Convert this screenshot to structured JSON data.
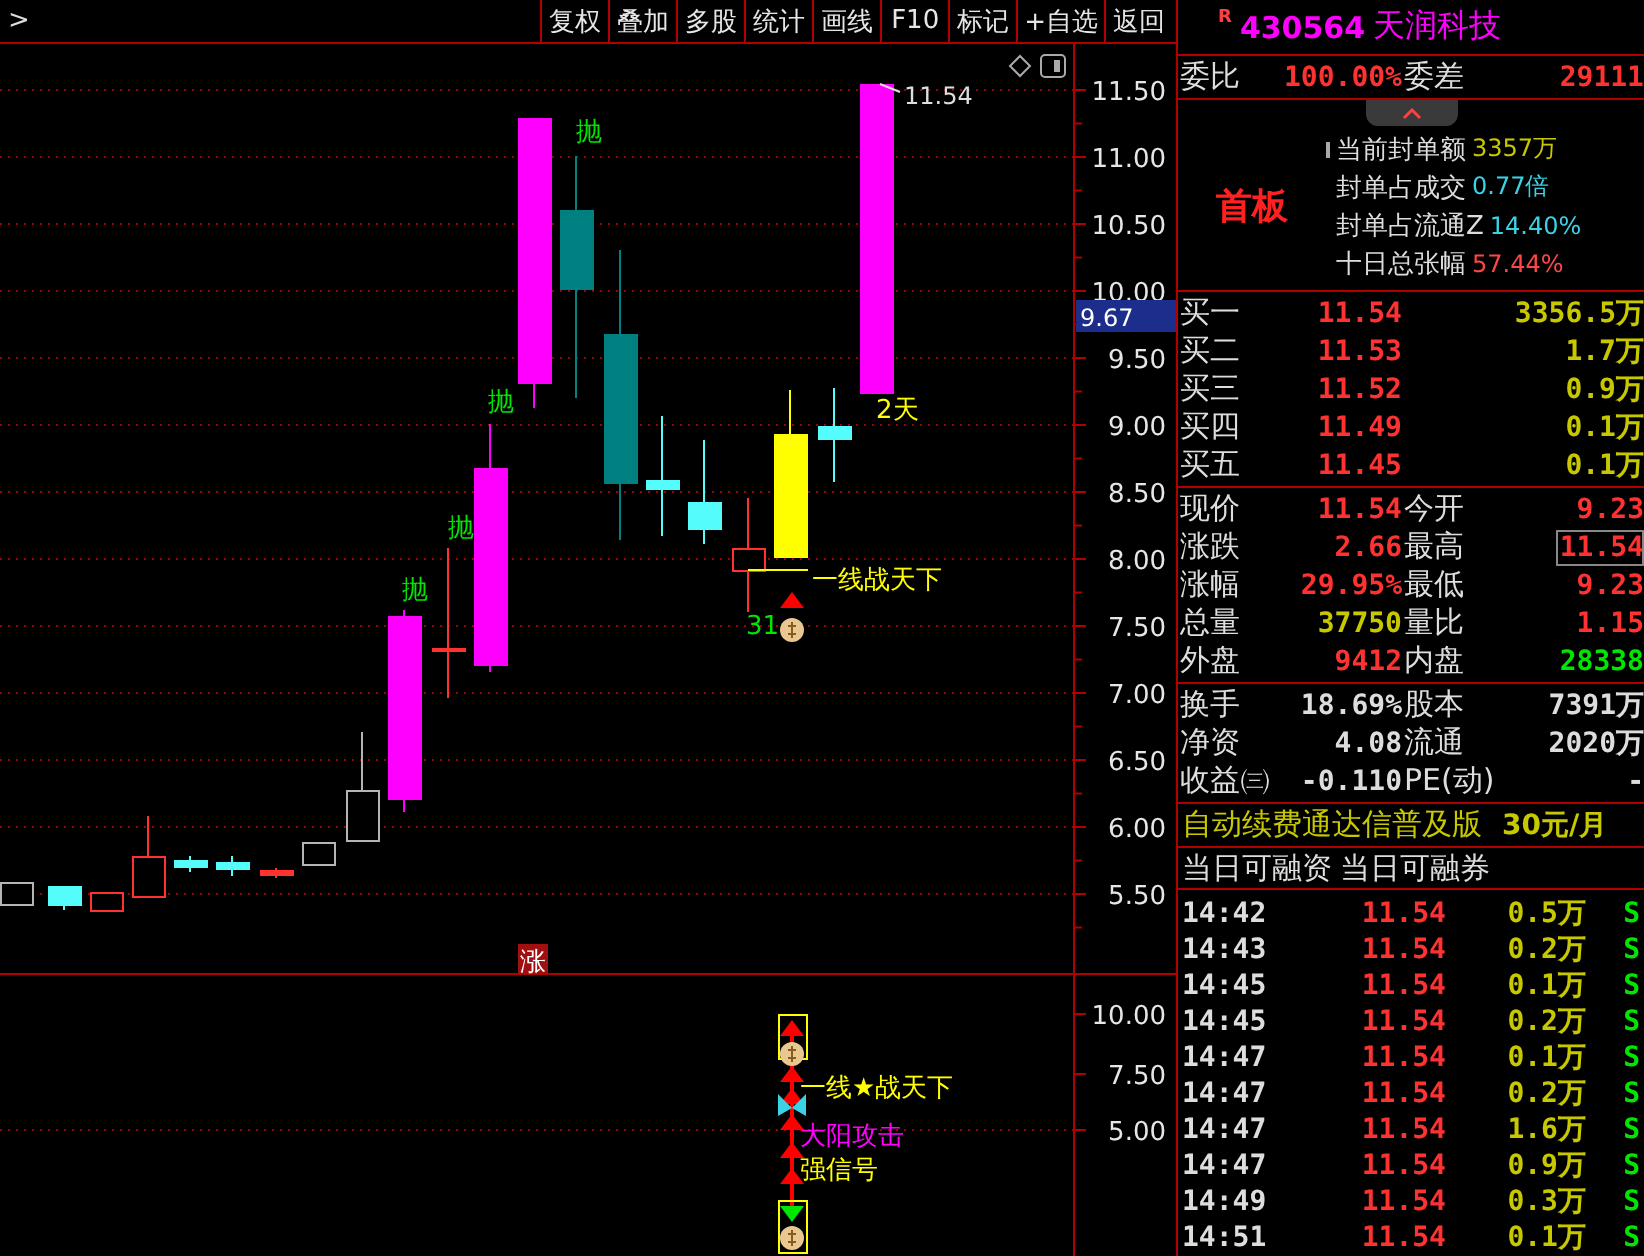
{
  "toolbar": {
    "breadcrumb": ">",
    "buttons": [
      "复权",
      "叠加",
      "多股",
      "统计",
      "画线",
      "F10",
      "标记",
      "+自选",
      "返回"
    ]
  },
  "chart": {
    "price_axis": [
      "11.50",
      "11.00",
      "10.50",
      "10.00",
      "9.50",
      "9.00",
      "8.50",
      "8.00",
      "7.50",
      "7.00",
      "6.50",
      "6.00",
      "5.50"
    ],
    "last_price_marker": "9.67",
    "high_label": "11.54",
    "rise_badge": "涨",
    "annotations": [
      {
        "text": "抛",
        "kind": "sell"
      },
      {
        "text": "抛",
        "kind": "sell"
      },
      {
        "text": "抛",
        "kind": "sell"
      },
      {
        "text": "抛",
        "kind": "sell"
      },
      {
        "text": "2天",
        "kind": "notice"
      },
      {
        "text": "一线战天下",
        "kind": "notice"
      },
      {
        "text": "31",
        "kind": "sell"
      }
    ],
    "indicator_axis": [
      "10.00",
      "7.50",
      "5.00"
    ],
    "signals": [
      {
        "text": "一线★战天下",
        "kind": "notice"
      },
      {
        "text": "大阳攻击",
        "kind": "attack"
      },
      {
        "text": "强信号",
        "kind": "notice"
      }
    ]
  },
  "stock": {
    "badge": "R",
    "code": "430564",
    "name": "天润科技"
  },
  "commission": {
    "ratio_label": "委比",
    "ratio": "100.00%",
    "diff_label": "委差",
    "diff": "29111"
  },
  "seal": {
    "tag": "首板",
    "items": [
      {
        "label": "当前封单额",
        "value": "3357万",
        "color": "#c8c800"
      },
      {
        "label": "封单占成交",
        "value": "0.77倍",
        "color": "#3cd2e6"
      },
      {
        "label": "封单占流通Z",
        "value": "14.40%",
        "color": "#3cd2e6"
      },
      {
        "label": "十日总张幅",
        "value": "57.44%",
        "color": "#ff4646"
      }
    ]
  },
  "bids": [
    {
      "label": "买一",
      "price": "11.54",
      "volume": "3356.5万"
    },
    {
      "label": "买二",
      "price": "11.53",
      "volume": "1.7万"
    },
    {
      "label": "买三",
      "price": "11.52",
      "volume": "0.9万"
    },
    {
      "label": "买四",
      "price": "11.49",
      "volume": "0.1万"
    },
    {
      "label": "买五",
      "price": "11.45",
      "volume": "0.1万"
    }
  ],
  "quote": [
    {
      "left": {
        "label": "现价",
        "value": "11.54",
        "color": "#ff3232"
      },
      "right": {
        "label": "今开",
        "value": "9.23",
        "color": "#ff3232",
        "highlighted": false
      }
    },
    {
      "left": {
        "label": "涨跌",
        "value": "2.66",
        "color": "#ff3232"
      },
      "right": {
        "label": "最高",
        "value": "11.54",
        "color": "#ff3232",
        "highlighted": true
      }
    },
    {
      "left": {
        "label": "涨幅",
        "value": "29.95%",
        "color": "#ff3232"
      },
      "right": {
        "label": "最低",
        "value": "9.23",
        "color": "#ff3232",
        "highlighted": false
      }
    },
    {
      "left": {
        "label": "总量",
        "value": "37750",
        "color": "#c8c800"
      },
      "right": {
        "label": "量比",
        "value": "1.15",
        "color": "#ff3232",
        "highlighted": false
      }
    },
    {
      "left": {
        "label": "外盘",
        "value": "9412",
        "color": "#ff3232"
      },
      "right": {
        "label": "内盘",
        "value": "28338",
        "color": "#00e600",
        "highlighted": false
      }
    }
  ],
  "fundamentals": [
    {
      "left": {
        "label": "换手",
        "value": "18.69%"
      },
      "right": {
        "label": "股本",
        "value": "7391万"
      }
    },
    {
      "left": {
        "label": "净资",
        "value": "4.08"
      },
      "right": {
        "label": "流通",
        "value": "2020万"
      }
    },
    {
      "left": {
        "label": "收益㈢",
        "value": "-0.110"
      },
      "right": {
        "label": "PE(动)",
        "value": "-"
      }
    }
  ],
  "ad": {
    "text": "自动续费通达信普及版",
    "price": "30元/月"
  },
  "margin": [
    "当日可融资",
    "当日可融券"
  ],
  "ticks": [
    {
      "time": "14:42",
      "price": "11.54",
      "volume": "0.5万",
      "side": "S"
    },
    {
      "time": "14:43",
      "price": "11.54",
      "volume": "0.2万",
      "side": "S"
    },
    {
      "time": "14:45",
      "price": "11.54",
      "volume": "0.1万",
      "side": "S"
    },
    {
      "time": "14:45",
      "price": "11.54",
      "volume": "0.2万",
      "side": "S"
    },
    {
      "time": "14:47",
      "price": "11.54",
      "volume": "0.1万",
      "side": "S"
    },
    {
      "time": "14:47",
      "price": "11.54",
      "volume": "0.2万",
      "side": "S"
    },
    {
      "time": "14:47",
      "price": "11.54",
      "volume": "1.6万",
      "side": "S"
    },
    {
      "time": "14:47",
      "price": "11.54",
      "volume": "0.9万",
      "side": "S"
    },
    {
      "time": "14:49",
      "price": "11.54",
      "volume": "0.3万",
      "side": "S"
    },
    {
      "time": "14:51",
      "price": "11.54",
      "volume": "0.1万",
      "side": "S"
    }
  ]
}
